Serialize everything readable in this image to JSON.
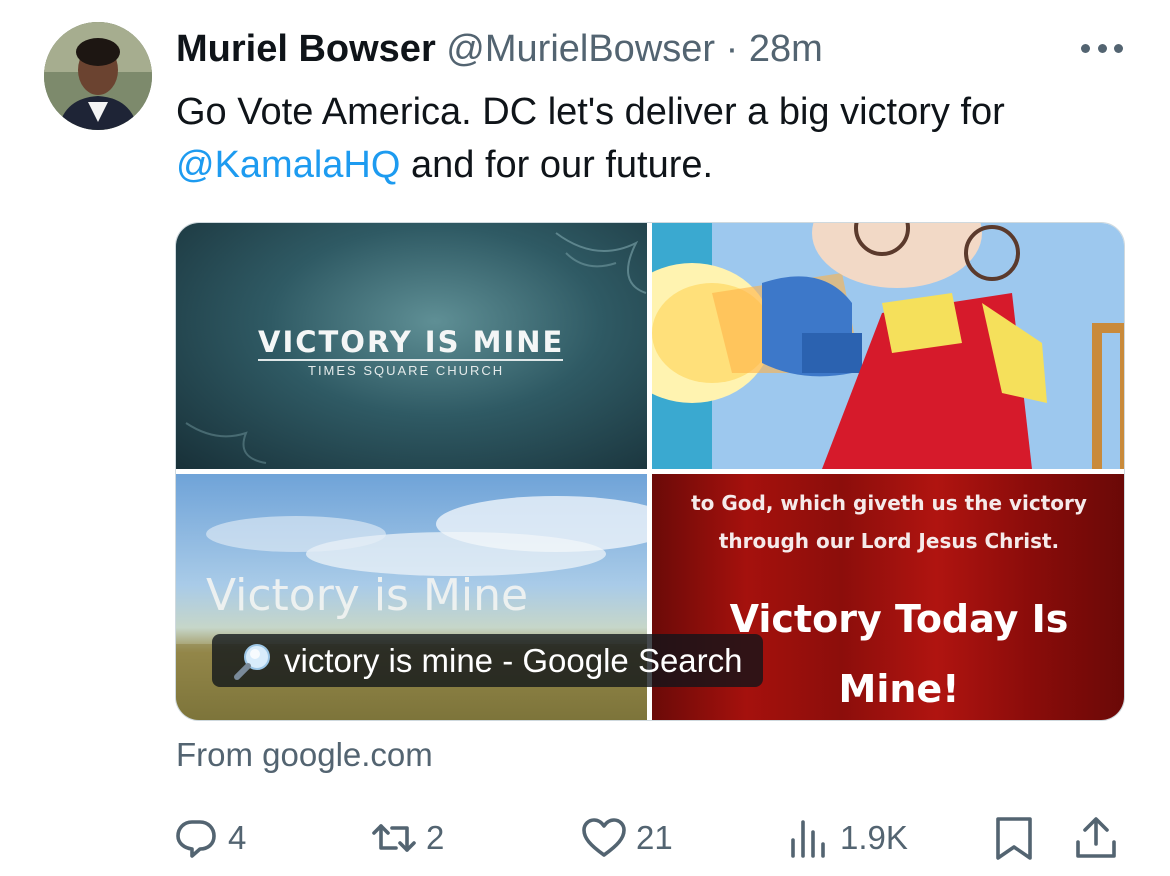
{
  "tweet": {
    "author_name": "Muriel Bowser",
    "handle": "@MurielBowser",
    "separator": "·",
    "time": "28m",
    "text_before": "Go Vote America.  DC let's deliver a big victory for",
    "mention": "@KamalaHQ",
    "text_after": " and for our future."
  },
  "media": {
    "tile1_title": "VICTORY IS MINE",
    "tile1_subtitle": "TIMES SQUARE CHURCH",
    "tile3_title": "Victory is Mine",
    "tile4_quote_line1": "to God, which giveth us the victory",
    "tile4_quote_line2": "through our Lord Jesus Christ.",
    "tile4_title_line1": "Victory Today Is",
    "tile4_title_line2": "Mine!",
    "search_label": "victory is mine - Google Search"
  },
  "source": "From google.com",
  "actions": {
    "replies": "4",
    "retweets": "2",
    "likes": "21",
    "views": "1.9K"
  },
  "icons": {
    "avatar": "profile-photo",
    "more": "more-horizontal-icon",
    "search": "magnifier-icon",
    "reply": "reply-icon",
    "retweet": "retweet-icon",
    "like": "heart-icon",
    "views": "views-icon",
    "bookmark": "bookmark-icon",
    "share": "share-icon"
  },
  "colors": {
    "link": "#1d9bf0",
    "text": "#0f1419",
    "secondary": "#536471"
  }
}
